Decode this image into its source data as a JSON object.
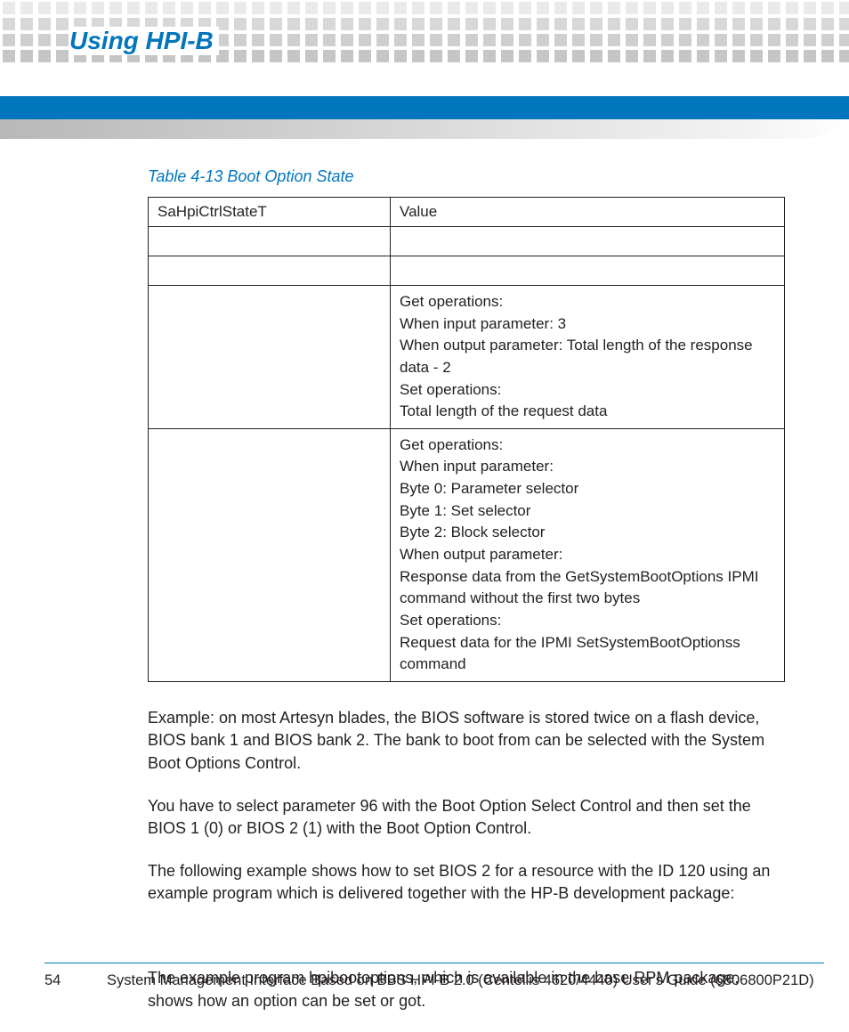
{
  "header": {
    "title": "Using HPI-B"
  },
  "table": {
    "caption": "Table 4-13 Boot Option State",
    "head": {
      "c1": "SaHpiCtrlStateT",
      "c2": "Value"
    },
    "rows": [
      {
        "c1": "",
        "c2_lines": [
          ""
        ]
      },
      {
        "c1": "",
        "c2_lines": [
          ""
        ]
      },
      {
        "c1": "",
        "c2_lines": [
          "Get operations:",
          "When input parameter: 3",
          "When output parameter: Total length of the response data - 2",
          "Set operations:",
          "Total length of the request data"
        ]
      },
      {
        "c1": "",
        "c2_lines": [
          "Get operations:",
          "When input parameter:",
          "Byte 0: Parameter selector",
          "Byte 1: Set selector",
          "Byte 2: Block selector",
          "When output parameter:",
          "Response data from the GetSystemBootOptions IPMI command without the first two bytes",
          "Set operations:",
          "Request data for the IPMI SetSystemBootOptionss command"
        ]
      }
    ]
  },
  "paragraphs": [
    "Example: on most Artesyn blades, the BIOS software is stored twice on a flash device, BIOS bank 1 and BIOS bank 2. The bank to boot from can be selected with the System Boot Options Control.",
    "You have to select parameter 96 with the Boot Option Select Control and then set the BIOS 1 (0) or BIOS 2 (1) with the Boot Option Control.",
    "The following example shows how to set BIOS 2 for a resource with the ID 120 using an example program which is delivered together with the HP-B development package:",
    "",
    "The example program hpibootoptions, which is available in the base RPM package, shows how an option can be set or got."
  ],
  "footer": {
    "page_number": "54",
    "text": "System Management Interface Based on BBS HPI-B 2.0 (Centellis 4620/4440) User's Guide (6806800P21D)"
  }
}
